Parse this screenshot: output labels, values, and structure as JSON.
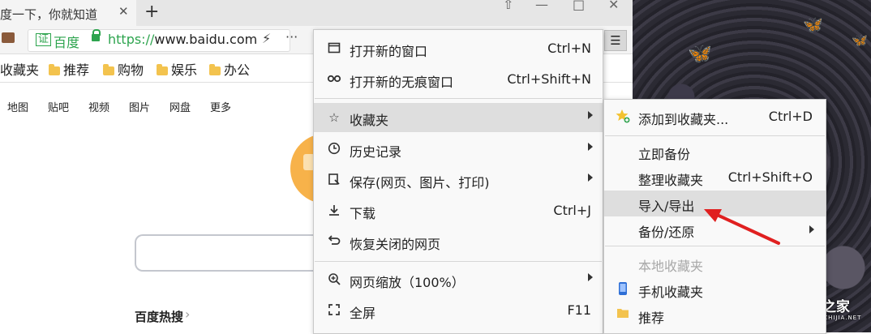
{
  "tab": {
    "title": "度一下，你就知道",
    "close": "✕",
    "new_tab": "+"
  },
  "window": {
    "pin": "⇧",
    "minimize": "—",
    "maximize": "□",
    "close": "✕"
  },
  "address_bar": {
    "cert_badge": "证",
    "site_name": "百度",
    "url_scheme": "https://",
    "url_host": "www.baidu.com",
    "bolt": "⚡",
    "more": "···",
    "menu_button": "☰"
  },
  "bookmarks": {
    "first": "收藏夹",
    "items": [
      "推荐",
      "购物",
      "娱乐",
      "办公"
    ]
  },
  "baidu": {
    "nav": [
      "地图",
      "贴吧",
      "视频",
      "图片",
      "网盘",
      "更多"
    ],
    "hot_title": "百度热搜",
    "hot_chevron": "›"
  },
  "main_menu": {
    "items": [
      {
        "label": "打开新的窗口",
        "shortcut": "Ctrl+N",
        "icon": "window-icon"
      },
      {
        "label": "打开新的无痕窗口",
        "shortcut": "Ctrl+Shift+N",
        "icon": "incognito-icon"
      },
      {
        "label": "收藏夹",
        "shortcut": "",
        "icon": "favorites-icon",
        "submenu": true,
        "highlighted": true
      },
      {
        "label": "历史记录",
        "shortcut": "",
        "icon": "history-icon",
        "submenu": true
      },
      {
        "label": "保存(网页、图片、打印)",
        "shortcut": "",
        "icon": "save-icon",
        "submenu": true
      },
      {
        "label": "下载",
        "shortcut": "Ctrl+J",
        "icon": "download-icon"
      },
      {
        "label": "恢复关闭的网页",
        "shortcut": "",
        "icon": "restore-icon"
      },
      {
        "label": "网页缩放（100%）",
        "shortcut": "",
        "icon": "zoom-icon",
        "submenu": true
      },
      {
        "label": "全屏",
        "shortcut": "F11",
        "icon": "fullscreen-icon"
      }
    ]
  },
  "sub_menu": {
    "items": [
      {
        "label": "添加到收藏夹...",
        "shortcut": "Ctrl+D",
        "icon": "add-star-icon"
      },
      {
        "label": "立即备份",
        "shortcut": ""
      },
      {
        "label": "整理收藏夹",
        "shortcut": "Ctrl+Shift+O"
      },
      {
        "label": "导入/导出",
        "shortcut": "",
        "highlighted": true
      },
      {
        "label": "备份/还原",
        "shortcut": "",
        "submenu": true
      },
      {
        "label": "本地收藏夹",
        "shortcut": "",
        "disabled": true
      },
      {
        "label": "手机收藏夹",
        "shortcut": "",
        "icon": "phone-icon"
      },
      {
        "label": "推荐",
        "shortcut": "",
        "icon": "folder-icon"
      }
    ]
  },
  "watermark": {
    "text": "系统之家",
    "sub": "XITONGZHIJIA.NET"
  },
  "colors": {
    "accent_green": "#2da44e",
    "highlight": "#dedede",
    "arrow_red": "#e02020",
    "butterfly": "#2c43c9"
  }
}
